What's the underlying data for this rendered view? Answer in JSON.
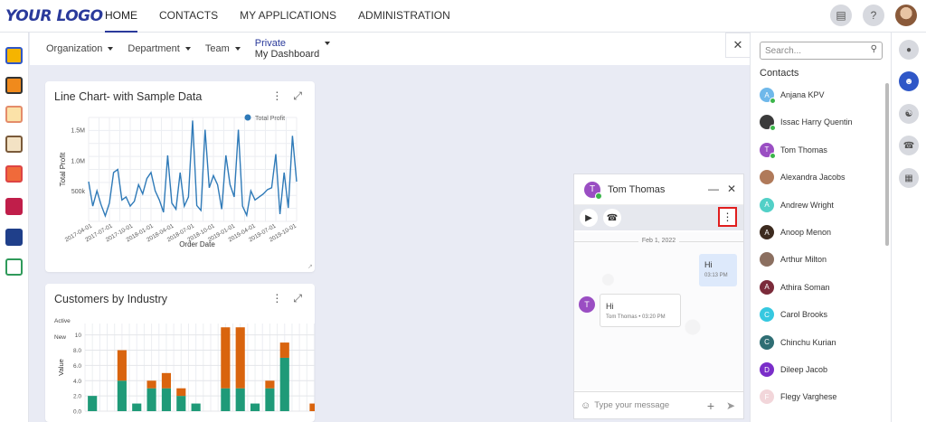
{
  "logo": "YOUR LOGO",
  "nav": [
    {
      "label": "HOME",
      "active": true
    },
    {
      "label": "CONTACTS"
    },
    {
      "label": "MY APPLICATIONS"
    },
    {
      "label": "ADMINISTRATION"
    }
  ],
  "filters": {
    "organization": "Organization",
    "department": "Department",
    "team": "Team",
    "dashboard_line1": "Private",
    "dashboard_line2": "My Dashboard"
  },
  "line_card": {
    "title": "Line Chart- with Sample Data"
  },
  "bar_card": {
    "title": "Customers by Industry"
  },
  "chart_data": [
    {
      "type": "line",
      "title": "Line Chart- with Sample Data",
      "xlabel": "Order Date",
      "ylabel": "Total Profit",
      "series": [
        {
          "name": "Total Profit",
          "color": "#2f7ab8",
          "values": [
            650,
            250,
            500,
            270,
            90,
            300,
            800,
            850,
            350,
            400,
            250,
            330,
            600,
            450,
            700,
            800,
            500,
            350,
            150,
            1080,
            300,
            200,
            800,
            250,
            400,
            1650,
            260,
            180,
            1500,
            550,
            750,
            600,
            200,
            1080,
            600,
            400,
            1500,
            250,
            100,
            500,
            350,
            400,
            450,
            520,
            550,
            1100,
            120,
            800,
            220,
            1400,
            650
          ]
        }
      ],
      "x_ticks": [
        "2017-04-01",
        "2017-07-01",
        "2017-10-01",
        "2018-01-01",
        "2018-04-01",
        "2018-07-01",
        "2018-10-01",
        "2019-01-01",
        "2019-04-01",
        "2019-07-01",
        "2019-10-01"
      ],
      "y_ticks": [
        "500k",
        "1.0M",
        "1.5M"
      ],
      "ylim": [
        0,
        1700
      ],
      "legend": "top-right",
      "grid": true
    },
    {
      "type": "bar",
      "stacked": true,
      "title": "Customers by Industry",
      "ylabel": "Value",
      "legend": [
        "Active",
        "New"
      ],
      "y_ticks": [
        "0.0",
        "2.0",
        "4.0",
        "6.0",
        "8.0",
        "10"
      ],
      "ylim": [
        0,
        11.5
      ],
      "series": [
        {
          "name": "Active",
          "color": "#1f9a78",
          "values": [
            2,
            0,
            4,
            1,
            3,
            3,
            2,
            1,
            0,
            3,
            3,
            1,
            3,
            7,
            0,
            0,
            0
          ]
        },
        {
          "name": "New",
          "color": "#d9640e",
          "values": [
            0,
            0,
            4,
            0,
            1,
            2,
            1,
            0,
            0,
            8,
            8,
            0,
            1,
            2,
            0,
            1,
            1
          ]
        }
      ]
    }
  ],
  "chat": {
    "name": "Tom Thomas",
    "initial": "T",
    "date": "Feb 1, 2022",
    "outgoing_text": "Hi",
    "outgoing_time": "03:13 PM",
    "incoming_text": "Hi",
    "incoming_meta": "Tom Thomas • 03:20 PM",
    "input_placeholder": "Type your message"
  },
  "contacts": {
    "search_placeholder": "Search...",
    "title": "Contacts",
    "items": [
      {
        "name": "Anjana KPV",
        "initial": "A",
        "color": "#6fb8ea",
        "online": true
      },
      {
        "name": "Issac Harry Quentin",
        "initial": "",
        "color": "#3b3b3b",
        "online": true
      },
      {
        "name": "Tom Thomas",
        "initial": "T",
        "color": "#9a4ec3",
        "online": true
      },
      {
        "name": "Alexandra Jacobs",
        "initial": "",
        "color": "#b07a5a",
        "online": false
      },
      {
        "name": "Andrew Wright",
        "initial": "A",
        "color": "#52d0c7",
        "online": false
      },
      {
        "name": "Anoop Menon",
        "initial": "A",
        "color": "#3d2b1f",
        "online": false
      },
      {
        "name": "Arthur Milton",
        "initial": "",
        "color": "#8b6f60",
        "online": false
      },
      {
        "name": "Athira Soman",
        "initial": "A",
        "color": "#7b2b3a",
        "online": false
      },
      {
        "name": "Carol Brooks",
        "initial": "C",
        "color": "#36c8e0",
        "online": false
      },
      {
        "name": "Chinchu Kurian",
        "initial": "C",
        "color": "#2f6e74",
        "online": false
      },
      {
        "name": "Dileep Jacob",
        "initial": "D",
        "color": "#7a2ec9",
        "online": false
      },
      {
        "name": "Flegy Varghese",
        "initial": "F",
        "color": "#f2d6da",
        "online": false
      }
    ]
  }
}
